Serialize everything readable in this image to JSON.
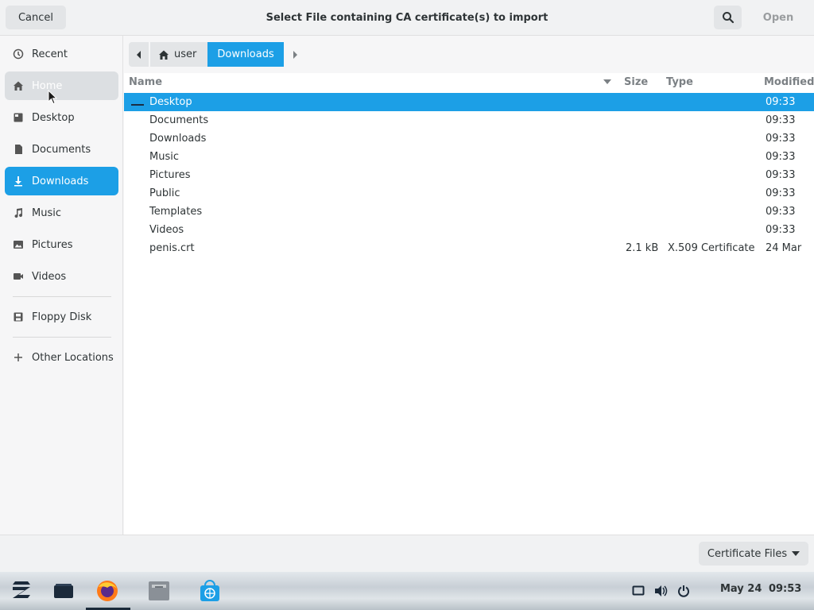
{
  "dialog": {
    "title": "Select File containing CA certificate(s) to import",
    "cancel_label": "Cancel",
    "open_label": "Open",
    "search_icon": "search-icon"
  },
  "sidebar": {
    "items": [
      {
        "label": "Recent",
        "icon": "clock-icon"
      },
      {
        "label": "Home",
        "icon": "home-icon"
      },
      {
        "label": "Desktop",
        "icon": "desktop-icon"
      },
      {
        "label": "Documents",
        "icon": "document-icon"
      },
      {
        "label": "Downloads",
        "icon": "download-icon"
      },
      {
        "label": "Music",
        "icon": "music-icon"
      },
      {
        "label": "Pictures",
        "icon": "picture-icon"
      },
      {
        "label": "Videos",
        "icon": "video-icon"
      },
      {
        "label": "Floppy Disk",
        "icon": "floppy-icon"
      },
      {
        "label": "Other Locations",
        "icon": "plus-icon"
      }
    ]
  },
  "pathbar": {
    "segments": [
      "user",
      "Downloads"
    ]
  },
  "filelist": {
    "columns": [
      "Name",
      "Size",
      "Type",
      "Modified"
    ],
    "rows": [
      {
        "name": "Desktop",
        "size": "",
        "type": "",
        "modified": "09:33"
      },
      {
        "name": "Documents",
        "size": "",
        "type": "",
        "modified": "09:33"
      },
      {
        "name": "Downloads",
        "size": "",
        "type": "",
        "modified": "09:33"
      },
      {
        "name": "Music",
        "size": "",
        "type": "",
        "modified": "09:33"
      },
      {
        "name": "Pictures",
        "size": "",
        "type": "",
        "modified": "09:33"
      },
      {
        "name": "Public",
        "size": "",
        "type": "",
        "modified": "09:33"
      },
      {
        "name": "Templates",
        "size": "",
        "type": "",
        "modified": "09:33"
      },
      {
        "name": "Videos",
        "size": "",
        "type": "",
        "modified": "09:33"
      },
      {
        "name": "penis.crt",
        "size": "2.1 kB",
        "type": "X.509 Certificate",
        "modified": "24 Mar"
      }
    ]
  },
  "footer": {
    "filter_label": "Certificate Files"
  },
  "taskbar": {
    "date": "May 24",
    "time": "09:53"
  },
  "colors": {
    "accent": "#1c9fe6",
    "text": "#2e3436"
  }
}
